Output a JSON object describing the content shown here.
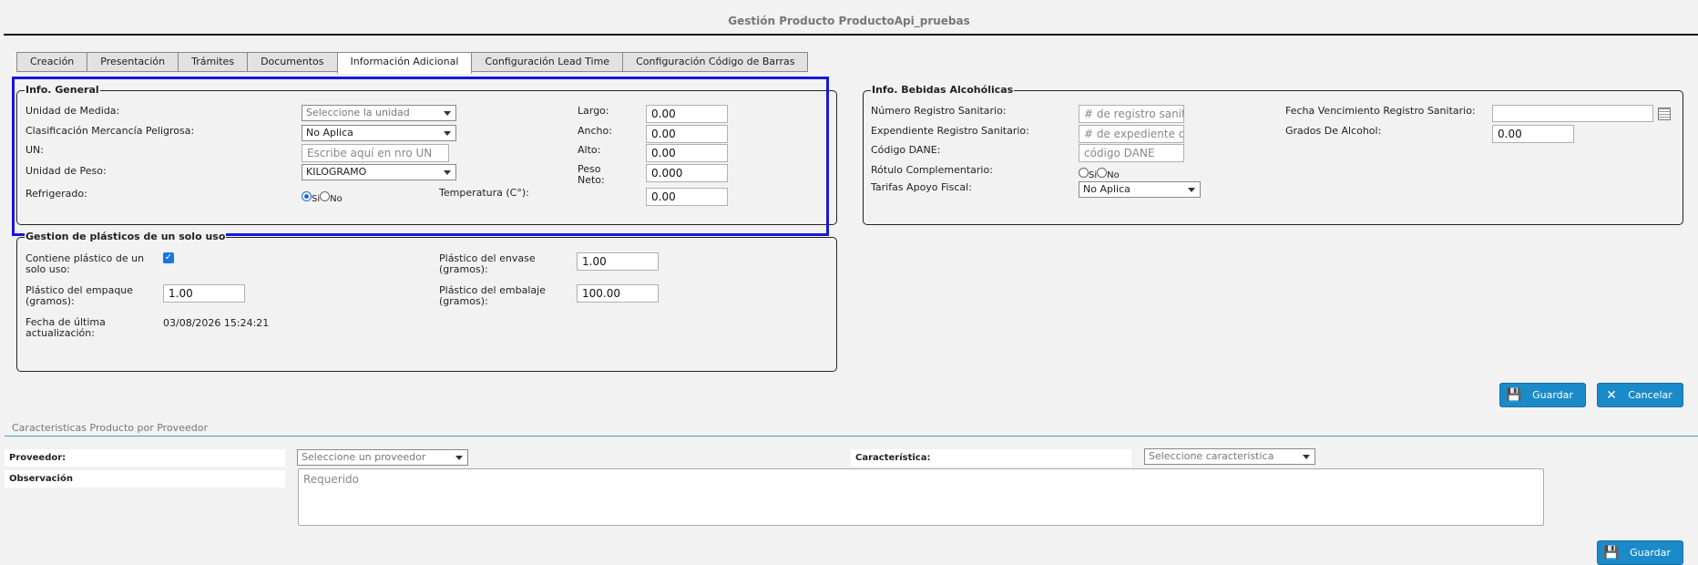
{
  "page": {
    "title": "Gestión Producto ProductoApi_pruebas"
  },
  "tabs": [
    {
      "label": "Creación",
      "active": false
    },
    {
      "label": "Presentación",
      "active": false
    },
    {
      "label": "Trámites",
      "active": false
    },
    {
      "label": "Documentos",
      "active": false
    },
    {
      "label": "Información Adicional",
      "active": true
    },
    {
      "label": "Configuración Lead Time",
      "active": false
    },
    {
      "label": "Configuración Código de Barras",
      "active": false
    }
  ],
  "info_general": {
    "legend": "Info. General",
    "unidad_medida": {
      "label": "Unidad de Medida:",
      "value": "Seleccione la unidad"
    },
    "clasificacion": {
      "label": "Clasificación Mercancía Peligrosa:",
      "value": "No Aplica"
    },
    "un": {
      "label": "UN:",
      "placeholder": "Escribe aquí en nro UN"
    },
    "unidad_peso": {
      "label": "Unidad de Peso:",
      "value": "KILOGRAMO"
    },
    "refrigerado": {
      "label": "Refrigerado:",
      "opt_si": "Si",
      "opt_no": "No",
      "selected": "Si"
    },
    "largo": {
      "label": "Largo:",
      "value": "0.00"
    },
    "ancho": {
      "label": "Ancho:",
      "value": "0.00"
    },
    "alto": {
      "label": "Alto:",
      "value": "0.00"
    },
    "peso_neto": {
      "label1": "Peso",
      "label2": "Neto:",
      "value": "0.000"
    },
    "temperatura": {
      "label": "Temperatura (C°):",
      "value": "0.00"
    }
  },
  "plasticos": {
    "legend": "Gestion de plásticos de un solo uso",
    "contiene": {
      "label1": "Contiene plástico de un",
      "label2": "solo uso:",
      "checked": true
    },
    "empaque": {
      "label1": "Plástico del empaque",
      "label2": "(gramos):",
      "value": "1.00"
    },
    "fecha": {
      "label1": "Fecha de última",
      "label2": "actualización:",
      "value": "03/08/2026 15:24:21"
    },
    "envase": {
      "label1": "Plástico del envase",
      "label2": "(gramos):",
      "value": "1.00"
    },
    "embalaje": {
      "label1": "Plástico del embalaje",
      "label2": "(gramos):",
      "value": "100.00"
    }
  },
  "bebidas": {
    "legend": "Info. Bebidas Alcohólicas",
    "registro": {
      "label": "Número Registro Sanitario:",
      "placeholder": "# de registro sanitario"
    },
    "expediente": {
      "label": "Expendiente Registro Sanitario:",
      "placeholder": "# de expediente de registro"
    },
    "dane": {
      "label": "Código DANE:",
      "placeholder": "código DANE"
    },
    "rotulo": {
      "label": "Rótulo Complementario:",
      "opt_si": "Si",
      "opt_no": "No"
    },
    "tarifas": {
      "label": "Tarifas Apoyo Fiscal:",
      "value": "No Aplica"
    },
    "vencimiento": {
      "label": "Fecha Vencimiento Registro Sanitario:",
      "value": ""
    },
    "grados": {
      "label": "Grados De Alcohol:",
      "value": "0.00"
    }
  },
  "actions": {
    "guardar": "Guardar",
    "cancelar": "Cancelar"
  },
  "proveedor_section": {
    "title": "Caracteristicas Producto por Proveedor",
    "proveedor_label": "Proveedor:",
    "proveedor_value": "Seleccione un proveedor",
    "caracteristica_label": "Característica:",
    "caracteristica_value": "Seleccione caracteristica",
    "observacion_label": "Observación",
    "observacion_placeholder": "Requerido",
    "guardar": "Guardar"
  },
  "colors": {
    "accent": "#1b8ac9",
    "highlight": "#1818d8",
    "section_line": "#3d9bd4"
  }
}
